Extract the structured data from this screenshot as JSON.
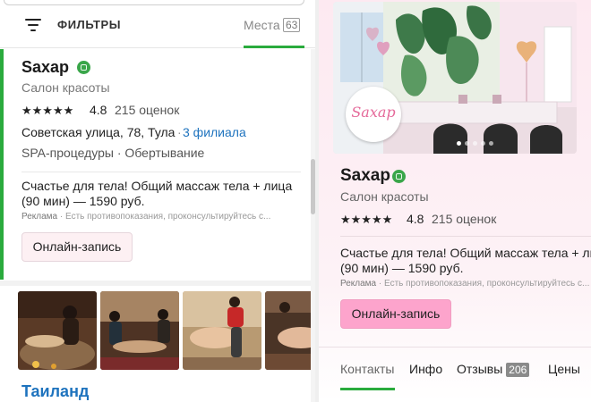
{
  "left_panel": {
    "filters_label": "ФИЛЬТРЫ",
    "places_tab": {
      "label": "Места",
      "count": "63"
    },
    "card": {
      "title": "Saxap",
      "category": "Салон красоты",
      "stars": "★★★★★",
      "rating": "4.8",
      "reviews": "215 оценок",
      "address": "Советская улица, 78, Тула",
      "separator": "·",
      "branches": "3 филиала",
      "services": "SPA-процедуры · Обертывание",
      "promo_line1": "Счастье для тела! Общий массаж тела + лица",
      "promo_line2": "(90 мин) — 1590 руб.",
      "ad_label": "Реклама",
      "ad_disclaimer": "· Есть противопоказания, проконсультируйтесь с...",
      "book_button": "Онлайн-запись"
    },
    "next_card_title": "Таиланд"
  },
  "right_panel": {
    "logo_text": "Saxap",
    "title": "Saxap",
    "category": "Салон красоты",
    "stars": "★★★★★",
    "rating": "4.8",
    "reviews": "215 оценок",
    "promo_line1": "Счастье для тела! Общий массаж тела + ли",
    "promo_line2": "(90 мин) — 1590 руб.",
    "ad_label": "Реклама",
    "ad_disclaimer": "· Есть противопоказания, проконсультируйтесь с...",
    "book_button": "Онлайн-запись",
    "tabs": [
      {
        "label": "Контакты"
      },
      {
        "label": "Инфо"
      },
      {
        "label": "Отзывы",
        "count": "206"
      },
      {
        "label": "Цены"
      }
    ],
    "carousel": {
      "slides": 5,
      "active": 1
    }
  },
  "colors": {
    "accent_green": "#2aab3d",
    "link_blue": "#1e73be",
    "book_button_pink": "#fda4cc",
    "panel_pink": "#fde9f1"
  },
  "icons": [
    "filter-icon",
    "verified-badge-icon",
    "star-icon"
  ]
}
